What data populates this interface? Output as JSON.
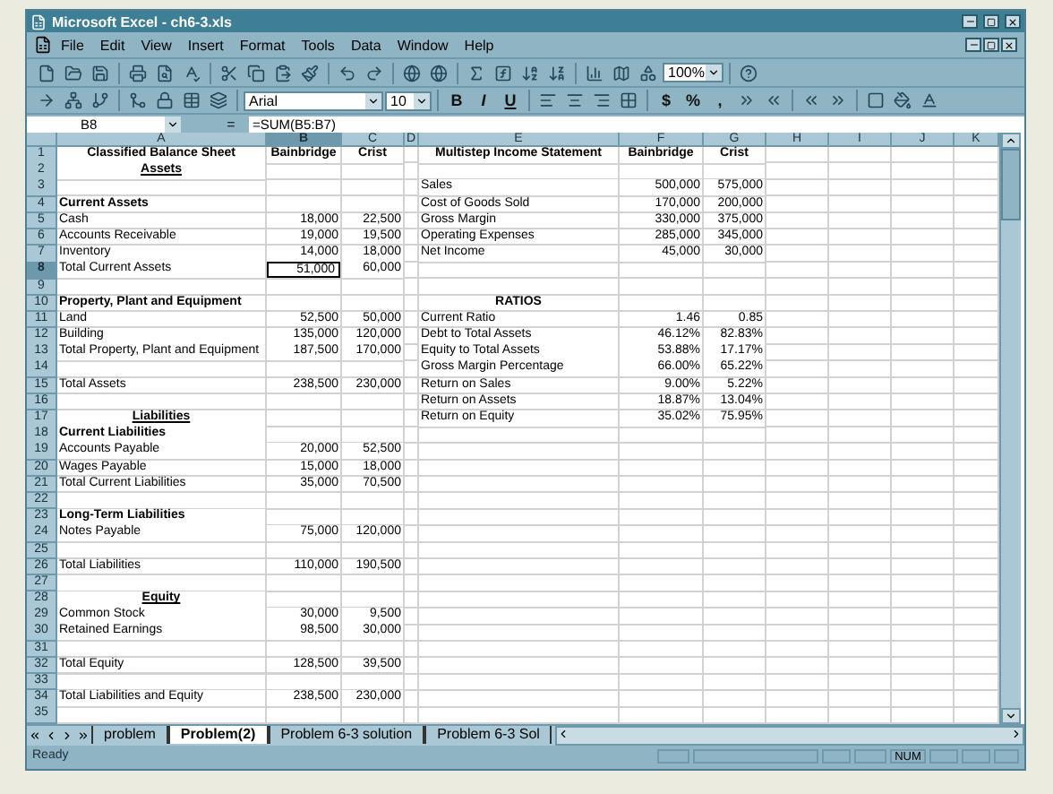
{
  "window": {
    "title": "Microsoft Excel - ch6-3.xls"
  },
  "menu": [
    "File",
    "Edit",
    "View",
    "Insert",
    "Format",
    "Tools",
    "Data",
    "Window",
    "Help"
  ],
  "toolbar": {
    "zoom": "100%"
  },
  "format_toolbar": {
    "font": "Arial",
    "size": "10",
    "style_buttons": [
      "B",
      "I",
      "U"
    ],
    "number_buttons": [
      "$",
      "%",
      ","
    ]
  },
  "formula_bar": {
    "name_box": "B8",
    "equals": "=",
    "formula": "=SUM(B5:B7)"
  },
  "columns": [
    "A",
    "B",
    "C",
    "D",
    "E",
    "F",
    "G",
    "H",
    "I",
    "J",
    "K"
  ],
  "rows": [
    {
      "number": "1",
      "cells": [
        {
          "text": "Classified Balance Sheet",
          "kind": "title",
          "selected": false
        },
        {
          "text": "Bainbridge",
          "kind": "title",
          "selected": false
        },
        {
          "text": "Crist",
          "kind": "title",
          "selected": false
        },
        null,
        {
          "text": "Multistep Income Statement",
          "kind": "title",
          "selected": false
        },
        {
          "text": "Bainbridge",
          "kind": "title",
          "selected": false
        },
        {
          "text": "Crist",
          "kind": "title",
          "selected": false
        }
      ]
    },
    {
      "number": "2",
      "cells": [
        {
          "text": "Assets",
          "kind": "section",
          "selected": false
        }
      ]
    },
    {
      "number": "3",
      "cells": [
        null,
        null,
        null,
        null,
        {
          "text": "Sales",
          "kind": "label",
          "selected": false
        },
        {
          "text": "500,000",
          "kind": "number",
          "selected": false
        },
        {
          "text": "575,000",
          "kind": "number",
          "selected": false
        }
      ]
    },
    {
      "number": "4",
      "cells": [
        {
          "text": "Current Assets",
          "kind": "heading",
          "selected": false
        },
        null,
        null,
        null,
        {
          "text": "Cost of Goods Sold",
          "kind": "label",
          "selected": false
        },
        {
          "text": "170,000",
          "kind": "number",
          "selected": false
        },
        {
          "text": "200,000",
          "kind": "number",
          "selected": false
        }
      ]
    },
    {
      "number": "5",
      "cells": [
        {
          "text": "Cash",
          "kind": "label",
          "selected": false
        },
        {
          "text": "18,000",
          "kind": "number",
          "selected": false
        },
        {
          "text": "22,500",
          "kind": "number",
          "selected": false
        },
        null,
        {
          "text": "Gross Margin",
          "kind": "label",
          "selected": false
        },
        {
          "text": "330,000",
          "kind": "number",
          "selected": false
        },
        {
          "text": "375,000",
          "kind": "number",
          "selected": false
        }
      ]
    },
    {
      "number": "6",
      "cells": [
        {
          "text": "Accounts Receivable",
          "kind": "label",
          "selected": false
        },
        {
          "text": "19,000",
          "kind": "number",
          "selected": false
        },
        {
          "text": "19,500",
          "kind": "number",
          "selected": false
        },
        null,
        {
          "text": "Operating Expenses",
          "kind": "label",
          "selected": false
        },
        {
          "text": "285,000",
          "kind": "number",
          "selected": false
        },
        {
          "text": "345,000",
          "kind": "number",
          "selected": false
        }
      ]
    },
    {
      "number": "7",
      "cells": [
        {
          "text": "Inventory",
          "kind": "label",
          "selected": false
        },
        {
          "text": "14,000",
          "kind": "number",
          "selected": false
        },
        {
          "text": "18,000",
          "kind": "number",
          "selected": false
        },
        null,
        {
          "text": "Net Income",
          "kind": "label",
          "selected": false
        },
        {
          "text": "45,000",
          "kind": "number",
          "selected": false
        },
        {
          "text": "30,000",
          "kind": "number",
          "selected": false
        }
      ]
    },
    {
      "number": "8",
      "cells": [
        {
          "text": "Total Current Assets",
          "kind": "label",
          "selected": false
        },
        {
          "text": "51,000",
          "kind": "number",
          "selected": true
        },
        {
          "text": "60,000",
          "kind": "number",
          "selected": false
        }
      ]
    },
    {
      "number": "9"
    },
    {
      "number": "10",
      "cells": [
        {
          "text": "Property, Plant and Equipment",
          "kind": "heading",
          "selected": false
        },
        null,
        null,
        null,
        {
          "text": "RATIOS",
          "kind": "title",
          "selected": false
        }
      ]
    },
    {
      "number": "11",
      "cells": [
        {
          "text": "Land",
          "kind": "label",
          "selected": false
        },
        {
          "text": "52,500",
          "kind": "number",
          "selected": false
        },
        {
          "text": "50,000",
          "kind": "number",
          "selected": false
        },
        null,
        {
          "text": "Current Ratio",
          "kind": "label",
          "selected": false
        },
        {
          "text": "1.46",
          "kind": "number",
          "selected": false
        },
        {
          "text": "0.85",
          "kind": "number",
          "selected": false
        }
      ]
    },
    {
      "number": "12",
      "cells": [
        {
          "text": "Building",
          "kind": "label",
          "selected": false
        },
        {
          "text": "135,000",
          "kind": "number",
          "selected": false
        },
        {
          "text": "120,000",
          "kind": "number",
          "selected": false
        },
        null,
        {
          "text": "Debt to Total Assets",
          "kind": "label",
          "selected": false
        },
        {
          "text": "46.12%",
          "kind": "number",
          "selected": false
        },
        {
          "text": "82.83%",
          "kind": "number",
          "selected": false
        }
      ]
    },
    {
      "number": "13",
      "cells": [
        {
          "text": "Total Property, Plant and Equipment",
          "kind": "label",
          "selected": false
        },
        {
          "text": "187,500",
          "kind": "number",
          "selected": false
        },
        {
          "text": "170,000",
          "kind": "number",
          "selected": false
        },
        null,
        {
          "text": "Equity to Total Assets",
          "kind": "label",
          "selected": false
        },
        {
          "text": "53.88%",
          "kind": "number",
          "selected": false
        },
        {
          "text": "17.17%",
          "kind": "number",
          "selected": false
        }
      ]
    },
    {
      "number": "14",
      "cells": [
        null,
        null,
        null,
        null,
        {
          "text": "Gross Margin Percentage",
          "kind": "label",
          "selected": false
        },
        {
          "text": "66.00%",
          "kind": "number",
          "selected": false
        },
        {
          "text": "65.22%",
          "kind": "number",
          "selected": false
        }
      ]
    },
    {
      "number": "15",
      "cells": [
        {
          "text": "Total Assets",
          "kind": "label",
          "selected": false
        },
        {
          "text": "238,500",
          "kind": "number",
          "selected": false
        },
        {
          "text": "230,000",
          "kind": "number",
          "selected": false
        },
        null,
        {
          "text": "Return on Sales",
          "kind": "label",
          "selected": false
        },
        {
          "text": "9.00%",
          "kind": "number",
          "selected": false
        },
        {
          "text": "5.22%",
          "kind": "number",
          "selected": false
        }
      ]
    },
    {
      "number": "16",
      "cells": [
        null,
        null,
        null,
        null,
        {
          "text": "Return on Assets",
          "kind": "label",
          "selected": false
        },
        {
          "text": "18.87%",
          "kind": "number",
          "selected": false
        },
        {
          "text": "13.04%",
          "kind": "number",
          "selected": false
        }
      ]
    },
    {
      "number": "17",
      "cells": [
        {
          "text": "Liabilities",
          "kind": "section",
          "selected": false
        },
        null,
        null,
        null,
        {
          "text": "Return on Equity",
          "kind": "label",
          "selected": false
        },
        {
          "text": "35.02%",
          "kind": "number",
          "selected": false
        },
        {
          "text": "75.95%",
          "kind": "number",
          "selected": false
        }
      ]
    },
    {
      "number": "18",
      "cells": [
        {
          "text": "Current Liabilities",
          "kind": "heading",
          "selected": false
        }
      ]
    },
    {
      "number": "19",
      "cells": [
        {
          "text": "Accounts Payable",
          "kind": "label",
          "selected": false
        },
        {
          "text": "20,000",
          "kind": "number",
          "selected": false
        },
        {
          "text": "52,500",
          "kind": "number",
          "selected": false
        }
      ]
    },
    {
      "number": "20",
      "cells": [
        {
          "text": "Wages Payable",
          "kind": "label",
          "selected": false
        },
        {
          "text": "15,000",
          "kind": "number",
          "selected": false
        },
        {
          "text": "18,000",
          "kind": "number",
          "selected": false
        }
      ]
    },
    {
      "number": "21",
      "cells": [
        {
          "text": "Total Current Liabilities",
          "kind": "label",
          "selected": false
        },
        {
          "text": "35,000",
          "kind": "number",
          "selected": false
        },
        {
          "text": "70,500",
          "kind": "number",
          "selected": false
        }
      ]
    },
    {
      "number": "22"
    },
    {
      "number": "23",
      "cells": [
        {
          "text": "Long-Term Liabilities",
          "kind": "heading",
          "selected": false
        }
      ]
    },
    {
      "number": "24",
      "cells": [
        {
          "text": "Notes Payable",
          "kind": "label",
          "selected": false
        },
        {
          "text": "75,000",
          "kind": "number",
          "selected": false
        },
        {
          "text": "120,000",
          "kind": "number",
          "selected": false
        }
      ]
    },
    {
      "number": "25"
    },
    {
      "number": "26",
      "cells": [
        {
          "text": "Total Liabilities",
          "kind": "label",
          "selected": false
        },
        {
          "text": "110,000",
          "kind": "number",
          "selected": false
        },
        {
          "text": "190,500",
          "kind": "number",
          "selected": false
        }
      ]
    },
    {
      "number": "27"
    },
    {
      "number": "28",
      "cells": [
        {
          "text": "Equity",
          "kind": "section",
          "selected": false
        }
      ]
    },
    {
      "number": "29",
      "cells": [
        {
          "text": "Common Stock",
          "kind": "label",
          "selected": false
        },
        {
          "text": "30,000",
          "kind": "number",
          "selected": false
        },
        {
          "text": "9,500",
          "kind": "number",
          "selected": false
        }
      ]
    },
    {
      "number": "30",
      "cells": [
        {
          "text": "Retained Earnings",
          "kind": "label",
          "selected": false
        },
        {
          "text": "98,500",
          "kind": "number",
          "selected": false
        },
        {
          "text": "30,000",
          "kind": "number",
          "selected": false
        }
      ]
    },
    {
      "number": "31"
    },
    {
      "number": "32",
      "cells": [
        {
          "text": "Total Equity",
          "kind": "label",
          "selected": false
        },
        {
          "text": "128,500",
          "kind": "number",
          "selected": false
        },
        {
          "text": "39,500",
          "kind": "number",
          "selected": false
        }
      ]
    },
    {
      "number": "33"
    },
    {
      "number": "34",
      "cells": [
        {
          "text": "Total Liabilities and Equity",
          "kind": "label",
          "selected": false
        },
        {
          "text": "238,500",
          "kind": "number",
          "selected": false
        },
        {
          "text": "230,000",
          "kind": "number",
          "selected": false
        }
      ]
    },
    {
      "number": "35"
    }
  ],
  "sheet_tabs": [
    {
      "label": "problem",
      "selected": false
    },
    {
      "label": "Problem(2)",
      "selected": true
    },
    {
      "label": "Problem 6-3 solution",
      "selected": false
    },
    {
      "label": "Problem 6-3 Sol",
      "selected": false
    }
  ],
  "status_bar": {
    "text": "Ready",
    "indicator": "NUM"
  }
}
